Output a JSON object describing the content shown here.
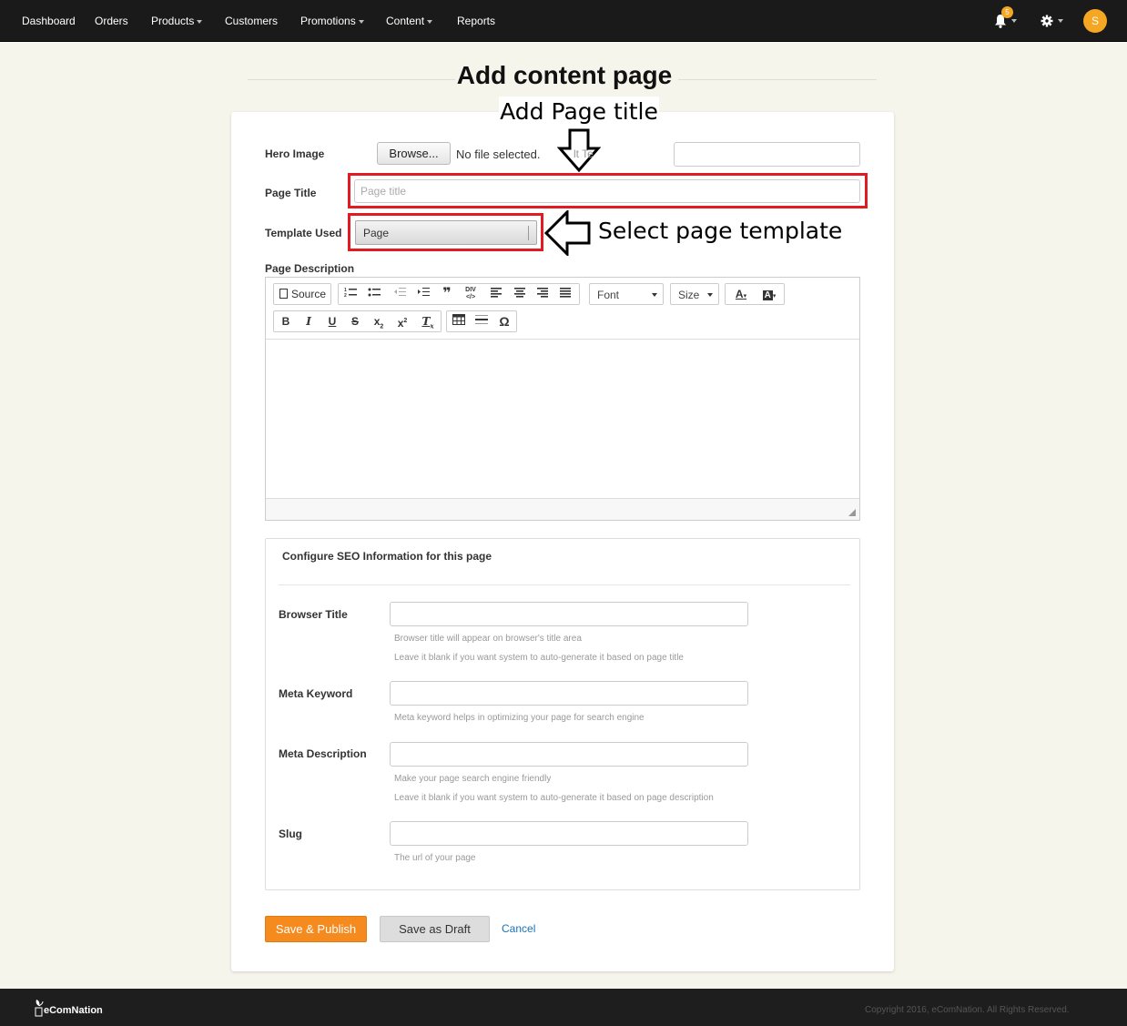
{
  "nav": {
    "items": [
      {
        "label": "Dashboard",
        "dropdown": false
      },
      {
        "label": "Orders",
        "dropdown": false
      },
      {
        "label": "Products",
        "dropdown": true
      },
      {
        "label": "Customers",
        "dropdown": false
      },
      {
        "label": "Promotions",
        "dropdown": true
      },
      {
        "label": "Content",
        "dropdown": true
      },
      {
        "label": "Reports",
        "dropdown": false
      }
    ],
    "notification_count": "5",
    "avatar_initial": "S"
  },
  "page": {
    "heading": "Add content page"
  },
  "annotations": {
    "title_hint": "Add Page title",
    "template_hint": "Select page template",
    "highlight_color": "#e11b22"
  },
  "form": {
    "hero_image_label": "Hero Image",
    "browse_label": "Browse...",
    "no_file_text": "No file selected.",
    "alt_text_partial": "lt Te",
    "page_title_label": "Page Title",
    "page_title_placeholder": "Page title",
    "template_label": "Template Used",
    "template_value": "Page",
    "description_label": "Page Description"
  },
  "editor": {
    "source_label": "Source",
    "font_label": "Font",
    "size_label": "Size",
    "font_color_label": "A",
    "bg_color_label": "A"
  },
  "seo": {
    "heading": "Configure SEO Information for this page",
    "browser_title_label": "Browser Title",
    "browser_title_help1": "Browser title will appear on browser's title area",
    "browser_title_help2": "Leave it blank if you want system to auto-generate it based on page title",
    "meta_keyword_label": "Meta Keyword",
    "meta_keyword_help": "Meta keyword helps in optimizing your page for search engine",
    "meta_description_label": "Meta Description",
    "meta_description_help1": "Make your page search engine friendly",
    "meta_description_help2": "Leave it blank if you want system to auto-generate it based on page description",
    "slug_label": "Slug",
    "slug_help": "The url of your page"
  },
  "actions": {
    "publish_label": "Save & Publish",
    "draft_label": "Save as Draft",
    "cancel_label": "Cancel",
    "publish_color": "#f58a1f"
  },
  "footer": {
    "brand": "eComNation",
    "copyright": "Copyright 2016, eComNation. All Rights Reserved."
  }
}
